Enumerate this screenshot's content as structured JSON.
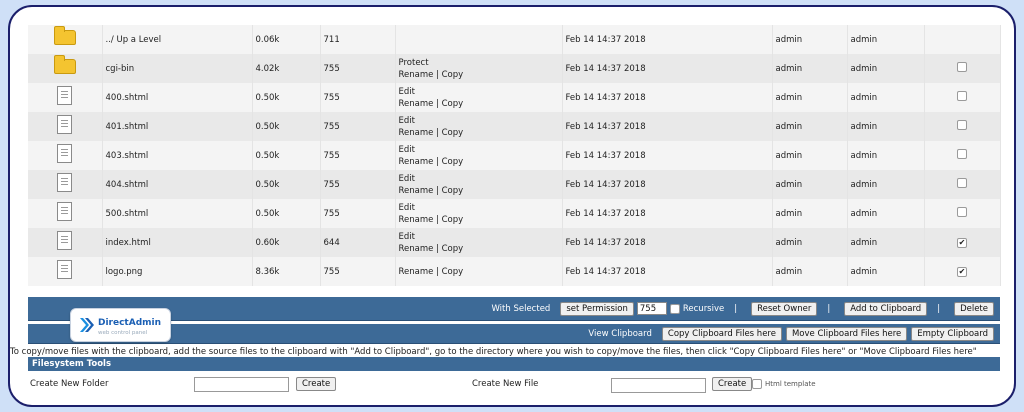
{
  "files": [
    {
      "icon": "folder-icon",
      "name": "../ Up a Level",
      "size": "0.06k",
      "perm": "711",
      "actions": [],
      "date": "Feb 14 14:37 2018",
      "owner": "admin",
      "group": "admin",
      "checkbox": false,
      "checked": false
    },
    {
      "icon": "folder-icon",
      "name": "cgi-bin",
      "size": "4.02k",
      "perm": "755",
      "actions": [
        "Protect",
        "Rename | Copy"
      ],
      "date": "Feb 14 14:37 2018",
      "owner": "admin",
      "group": "admin",
      "checkbox": true,
      "checked": false
    },
    {
      "icon": "file-icon",
      "name": "400.shtml",
      "size": "0.50k",
      "perm": "755",
      "actions": [
        "Edit",
        "Rename | Copy"
      ],
      "date": "Feb 14 14:37 2018",
      "owner": "admin",
      "group": "admin",
      "checkbox": true,
      "checked": false
    },
    {
      "icon": "file-icon",
      "name": "401.shtml",
      "size": "0.50k",
      "perm": "755",
      "actions": [
        "Edit",
        "Rename | Copy"
      ],
      "date": "Feb 14 14:37 2018",
      "owner": "admin",
      "group": "admin",
      "checkbox": true,
      "checked": false
    },
    {
      "icon": "file-icon",
      "name": "403.shtml",
      "size": "0.50k",
      "perm": "755",
      "actions": [
        "Edit",
        "Rename | Copy"
      ],
      "date": "Feb 14 14:37 2018",
      "owner": "admin",
      "group": "admin",
      "checkbox": true,
      "checked": false
    },
    {
      "icon": "file-icon",
      "name": "404.shtml",
      "size": "0.50k",
      "perm": "755",
      "actions": [
        "Edit",
        "Rename | Copy"
      ],
      "date": "Feb 14 14:37 2018",
      "owner": "admin",
      "group": "admin",
      "checkbox": true,
      "checked": false
    },
    {
      "icon": "file-icon",
      "name": "500.shtml",
      "size": "0.50k",
      "perm": "755",
      "actions": [
        "Edit",
        "Rename | Copy"
      ],
      "date": "Feb 14 14:37 2018",
      "owner": "admin",
      "group": "admin",
      "checkbox": true,
      "checked": false
    },
    {
      "icon": "file-icon",
      "name": "index.html",
      "size": "0.60k",
      "perm": "644",
      "actions": [
        "Edit",
        "Rename | Copy"
      ],
      "date": "Feb 14 14:37 2018",
      "owner": "admin",
      "group": "admin",
      "checkbox": true,
      "checked": true
    },
    {
      "icon": "file-icon",
      "name": "logo.png",
      "size": "8.36k",
      "perm": "755",
      "actions": [
        "Rename | Copy"
      ],
      "date": "Feb 14 14:37 2018",
      "owner": "admin",
      "group": "admin",
      "checkbox": true,
      "checked": true
    }
  ],
  "selected_bar": {
    "label": "With Selected",
    "set_permission_label": "set Permission",
    "permission_value": "755",
    "recursive_label": "Recursive",
    "separator": "|",
    "reset_owner_label": "Reset Owner",
    "add_clipboard_label": "Add to Clipboard",
    "delete_label": "Delete"
  },
  "clipboard_bar": {
    "label": "View Clipboard",
    "copy_label": "Copy Clipboard Files here",
    "move_label": "Move Clipboard Files here",
    "empty_label": "Empty Clipboard"
  },
  "hint_text": "To copy/move files with the clipboard, add the source files to the clipboard with \"Add to Clipboard\", go to the directory where you wish to copy/move the files, then click \"Copy Clipboard Files here\" or \"Move Clipboard Files here\"",
  "fs_tools": {
    "title": "Filesystem Tools",
    "new_folder_label": "Create New Folder",
    "new_file_label": "Create New File",
    "create_label": "Create",
    "html_template_label": "Html template"
  },
  "logo": {
    "name": "DirectAdmin",
    "tagline": "web control panel"
  },
  "colors": {
    "bar": "#3d6a97",
    "frame": "#1b1f6b",
    "background": "#cfe0f7"
  }
}
